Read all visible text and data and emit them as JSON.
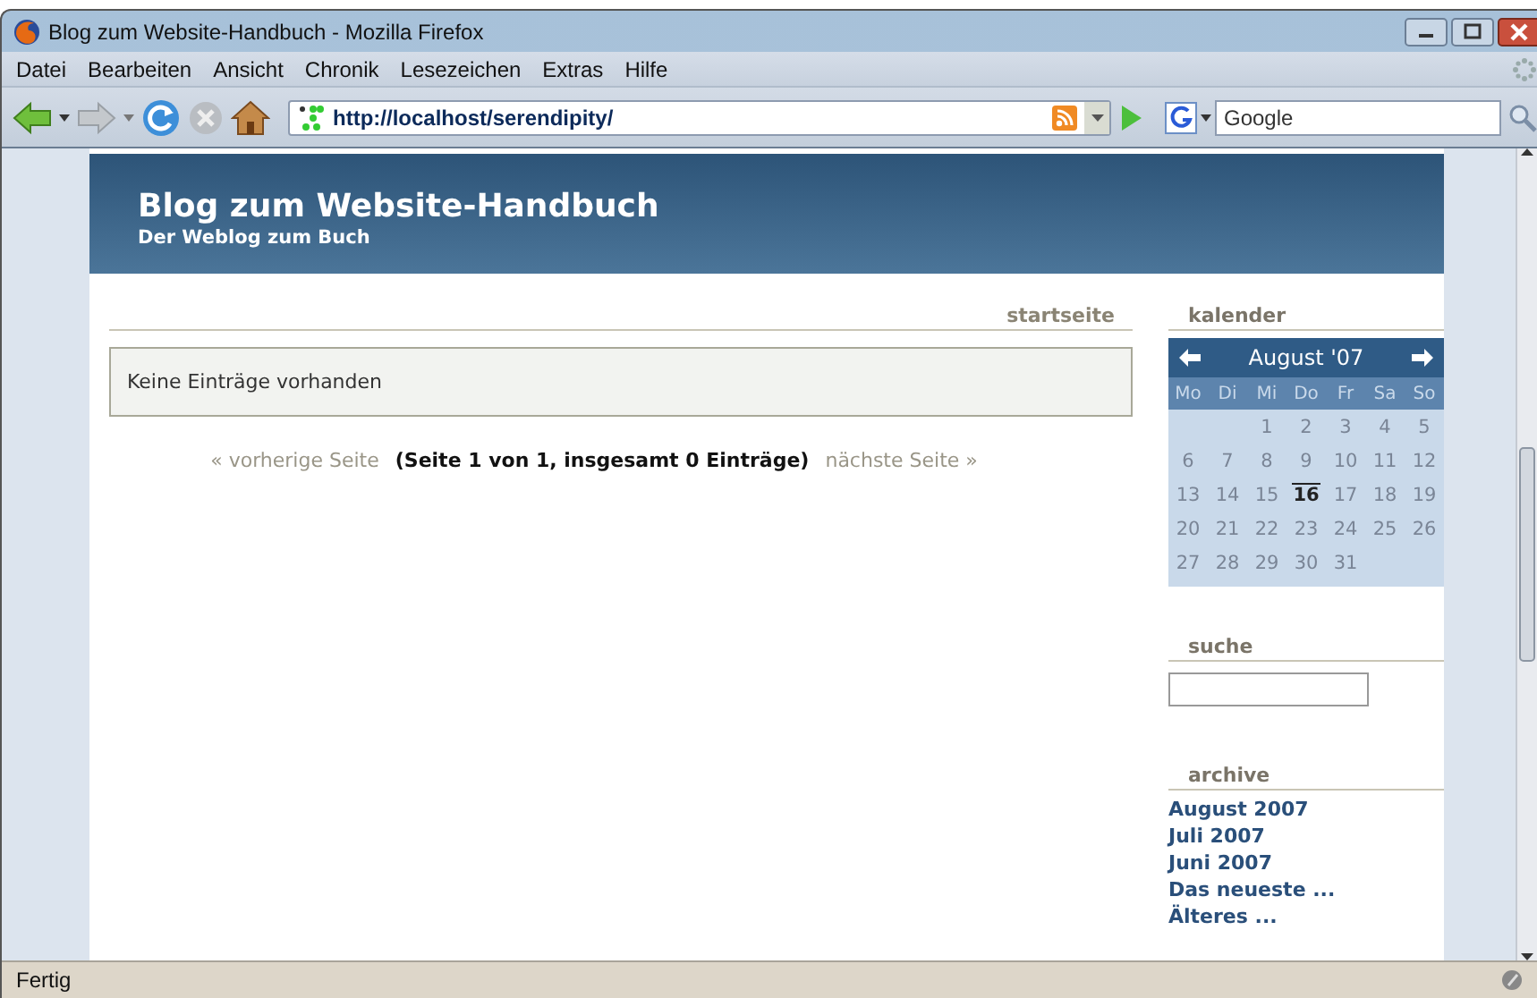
{
  "window": {
    "title": "Blog zum Website-Handbuch - Mozilla Firefox"
  },
  "menu": [
    "Datei",
    "Bearbeiten",
    "Ansicht",
    "Chronik",
    "Lesezeichen",
    "Extras",
    "Hilfe"
  ],
  "toolbar": {
    "url": "http://localhost/serendipity/",
    "search_placeholder": "Google"
  },
  "blog": {
    "title": "Blog zum Website-Handbuch",
    "subtitle": "Der Weblog zum Buch",
    "nav_link": "startseite",
    "message": "Keine Einträge vorhanden",
    "pager": {
      "prev": "« vorherige Seite",
      "info": "(Seite 1 von 1, insgesamt 0 Einträge)",
      "next": "nächste Seite »"
    }
  },
  "sidebar": {
    "calendar": {
      "heading": "kalender",
      "month": "August '07",
      "weekdays": [
        "Mo",
        "Di",
        "Mi",
        "Do",
        "Fr",
        "Sa",
        "So"
      ],
      "weeks": [
        [
          {
            "day": "1",
            "today": false
          },
          {
            "day": "2",
            "today": false
          },
          {
            "day": "3",
            "today": false
          },
          {
            "day": "4",
            "today": false
          },
          {
            "day": "5",
            "today": false
          }
        ],
        [
          {
            "day": "6",
            "today": false
          },
          {
            "day": "7",
            "today": false
          },
          {
            "day": "8",
            "today": false
          },
          {
            "day": "9",
            "today": false
          },
          {
            "day": "10",
            "today": false
          },
          {
            "day": "11",
            "today": false
          },
          {
            "day": "12",
            "today": false
          }
        ],
        [
          {
            "day": "13",
            "today": false
          },
          {
            "day": "14",
            "today": false
          },
          {
            "day": "15",
            "today": false
          },
          {
            "day": "16",
            "today": true
          },
          {
            "day": "17",
            "today": false
          },
          {
            "day": "18",
            "today": false
          },
          {
            "day": "19",
            "today": false
          }
        ],
        [
          {
            "day": "20",
            "today": false
          },
          {
            "day": "21",
            "today": false
          },
          {
            "day": "22",
            "today": false
          },
          {
            "day": "23",
            "today": false
          },
          {
            "day": "24",
            "today": false
          },
          {
            "day": "25",
            "today": false
          },
          {
            "day": "26",
            "today": false
          }
        ],
        [
          {
            "day": "27",
            "today": false
          },
          {
            "day": "28",
            "today": false
          },
          {
            "day": "29",
            "today": false
          },
          {
            "day": "30",
            "today": false
          },
          {
            "day": "31",
            "today": false
          }
        ]
      ]
    },
    "search": {
      "heading": "suche"
    },
    "archive": {
      "heading": "archive",
      "links": [
        "August 2007",
        "Juli 2007",
        "Juni 2007",
        "Das neueste ...",
        "Älteres ..."
      ]
    }
  },
  "status_bar": {
    "text": "Fertig"
  }
}
